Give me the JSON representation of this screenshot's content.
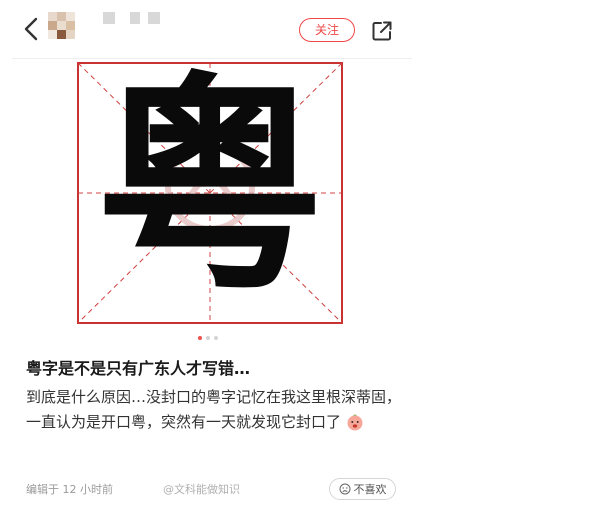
{
  "header": {
    "follow_label": "关注",
    "icons": {
      "back": "chevron-left-icon",
      "share": "share-external-icon"
    }
  },
  "post": {
    "image_character": "粤",
    "carousel": {
      "count": 3,
      "active": 1
    },
    "title": "粤字是不是只有广东人才写错…",
    "body": "到底是什么原因…没封口的粤字记忆在我这里根深蒂固，一直认为是开口粤，突然有一天就发现它封口了",
    "edited_time": "编辑于 12 小时前",
    "watermark": "@文科能做知识",
    "dislike_label": "不喜欢"
  },
  "colors": {
    "accent": "#f04848",
    "grid_red": "#c83232",
    "text_dark": "#1a1a1a",
    "meta_gray": "#9a9a9a"
  }
}
